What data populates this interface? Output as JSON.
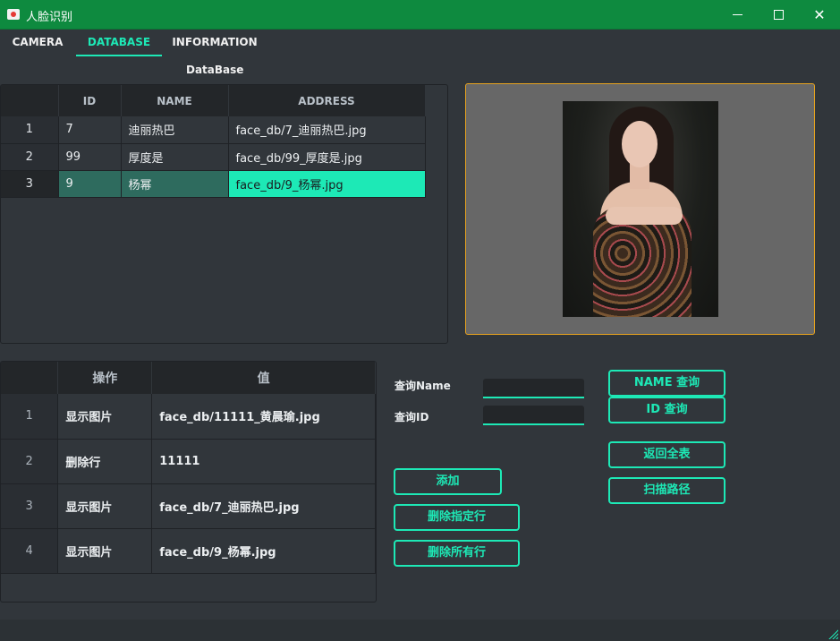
{
  "window": {
    "title": "人脸识别",
    "icon": "camera-app-icon"
  },
  "tabs": [
    {
      "label": "CAMERA",
      "active": false
    },
    {
      "label": "DATABASE",
      "active": true
    },
    {
      "label": "INFORMATION",
      "active": false
    }
  ],
  "database": {
    "caption": "DataBase",
    "columns": [
      "ID",
      "NAME",
      "ADDRESS"
    ],
    "rows": [
      {
        "num": "1",
        "id": "7",
        "name": "迪丽热巴",
        "address": "face_db/7_迪丽热巴.jpg"
      },
      {
        "num": "2",
        "id": "99",
        "name": "厚度是",
        "address": "face_db/99_厚度是.jpg"
      },
      {
        "num": "3",
        "id": "9",
        "name": "杨幂",
        "address": "face_db/9_杨幂.jpg"
      }
    ],
    "selected_row": 3
  },
  "log": {
    "columns": [
      "操作",
      "值"
    ],
    "rows": [
      {
        "num": "1",
        "op": "显示图片",
        "value": "face_db/11111_黄晨瑜.jpg"
      },
      {
        "num": "2",
        "op": "删除行",
        "value": "11111"
      },
      {
        "num": "3",
        "op": "显示图片",
        "value": "face_db/7_迪丽热巴.jpg"
      },
      {
        "num": "4",
        "op": "显示图片",
        "value": "face_db/9_杨幂.jpg"
      }
    ]
  },
  "query": {
    "name_label": "查询Name",
    "id_label": "查询ID",
    "name_value": "",
    "id_value": ""
  },
  "buttons": {
    "name_query": "NAME 查询",
    "id_query": "ID 查询",
    "return_all": "返回全表",
    "scan_path": "扫描路径",
    "add": "添加",
    "delete_row": "删除指定行",
    "delete_all": "删除所有行"
  },
  "colors": {
    "accent": "#1de9b6",
    "titlebar": "#0e8a3f",
    "background": "#31363b",
    "preview_border": "#e6a21e"
  }
}
